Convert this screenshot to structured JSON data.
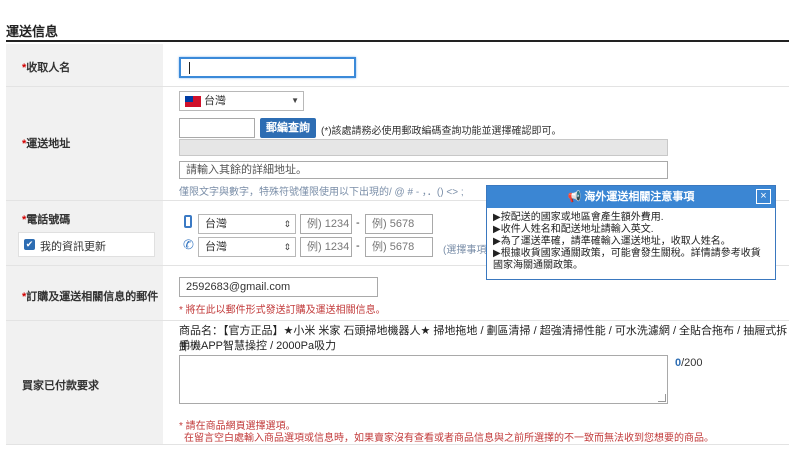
{
  "section_title": "運送信息",
  "recipient": {
    "label": "收取人名",
    "required_mark": "*"
  },
  "address": {
    "label": "運送地址",
    "required_mark": "*",
    "country": "台灣",
    "postcode_button": "郵編查詢",
    "postcode_note": "(*)該處請務必使用郵政編碼查詢功能並選擇確認即可。",
    "detail_placeholder": "請輸入其餘的詳細地址。",
    "hint": "僅限文字與數字，特殊符號僅限使用以下出現的/ @ # - ，．() <> ;"
  },
  "phone": {
    "label": "電話號碼",
    "required_mark": "*",
    "mobile_country": "台灣",
    "mobile_part1_placeholder": "例) 1234",
    "mobile_part2_placeholder": "例) 5678",
    "tel_country": "台灣",
    "tel_part1_placeholder": "例) 1234",
    "tel_part2_placeholder": "例) 5678",
    "optional_note": "(選擇事項",
    "separator": "-",
    "update_checkbox_label": "我的資訊更新"
  },
  "email": {
    "label": "訂購及運送相關信息的郵件",
    "required_mark": "*",
    "value": "2592683@gmail.com",
    "hint": "* 將在此以郵件形式發送訂購及運送相關信息。"
  },
  "buyer_request": {
    "label": "買家已付款要求",
    "product_line1": "商品名：【官方正品】★小米 米家 石頭掃地機器人★ 掃地拖地 / 劃區清掃 / 超強清掃性能 / 可水洗濾網 / 全貼合拖布 / 抽屜式拆卸 /",
    "product_line2": "手機APP智慧操控 / 2000Pa吸力",
    "counter_current": "0",
    "counter_max": "/200",
    "note_line1": "* 請在商品網頁選擇選項。",
    "note_line2": "在留言空白處輸入商品選項或信息時，如果賣家沒有查看或者商品信息與之前所選擇的不一致而無法收到您想要的商品。"
  },
  "popup": {
    "title": "海外運送相關注意事項",
    "close": "×",
    "lines": [
      "▶按配送的國家或地區會產生額外費用.",
      "▶收件人姓名和配送地址請輸入英文.",
      "▶為了運送準確，請準確輸入運送地址，收取人姓名。",
      "▶根據收貨國家通關政策，可能會發生關稅。詳情請參考收貨國家海關通關政策。"
    ]
  },
  "colors": {
    "accent": "#2d6db3",
    "popup_header": "#3b86d3",
    "required": "#d20000",
    "label_bg": "#f1f1f1"
  }
}
